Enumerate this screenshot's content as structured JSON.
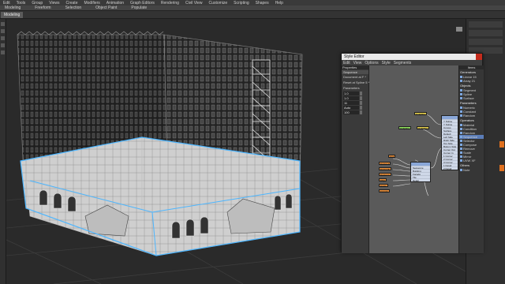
{
  "menubar": {
    "items": [
      "Edit",
      "Tools",
      "Group",
      "Views",
      "Create",
      "Modifiers",
      "Animation",
      "Graph Editors",
      "Rendering",
      "Civil View",
      "Customize",
      "Scripting",
      "Shapes",
      "Help"
    ]
  },
  "ribbon": {
    "tabs": [
      "Modeling",
      "Freeform",
      "Selection",
      "Object Paint",
      "Populate"
    ]
  },
  "subbar": {
    "active_tab": "Modeling"
  },
  "slate": {
    "title": "Style Editor",
    "menu": [
      "Edit",
      "View",
      "Options",
      "Style",
      "Segments"
    ],
    "properties": {
      "header": "Properties",
      "sub": "Sequence",
      "doc_label": "Document at F *",
      "reset_label": "Reset at Spline 5 *",
      "field_group": "Parameters",
      "fields": [
        "1.0",
        "1.0",
        "11",
        "Auto",
        "100"
      ]
    },
    "graph_nodes": {
      "y1": "Y: Spline",
      "y2": "Y: Spline",
      "green1": "Y: Spline",
      "o1": "Unit",
      "o2": "Sector A",
      "o3": "Sector B",
      "o4": "Sector C",
      "o5": "Ship",
      "o6": "Scale",
      "o7": "Facade",
      "seq_rows": [
        "Sequence",
        "Building",
        "Facade",
        "Tile",
        "Detail"
      ],
      "big_rows": [
        "Y Spline",
        "Y Spline",
        "Curves",
        "Surface",
        "Default",
        "Left Side",
        "Right Side",
        "Top Side",
        "Bottom Side",
        "Corner Out",
        "Corner In",
        "1 Corner",
        "2 Corner",
        "3 Corner",
        "1 Detail",
        "2 Detail"
      ]
    },
    "items": {
      "title": "Items",
      "generators_label": "Generators",
      "generators": [
        "Linear 15",
        "Array 21"
      ],
      "objects_label": "Objects",
      "objects": [
        "Segment",
        "Spline",
        "Surface"
      ],
      "parameters_label": "Parameters",
      "parameters": [
        "Numeric",
        "Constant",
        "Random"
      ],
      "operators_label": "Operators",
      "operators": [
        "Material",
        "Condition",
        "Random",
        "Sequence",
        "Selector",
        "Compose",
        "Remove",
        "Scale",
        "Mirror",
        "UVW XF"
      ],
      "others_label": "Others",
      "others": [
        "Note"
      ]
    }
  }
}
